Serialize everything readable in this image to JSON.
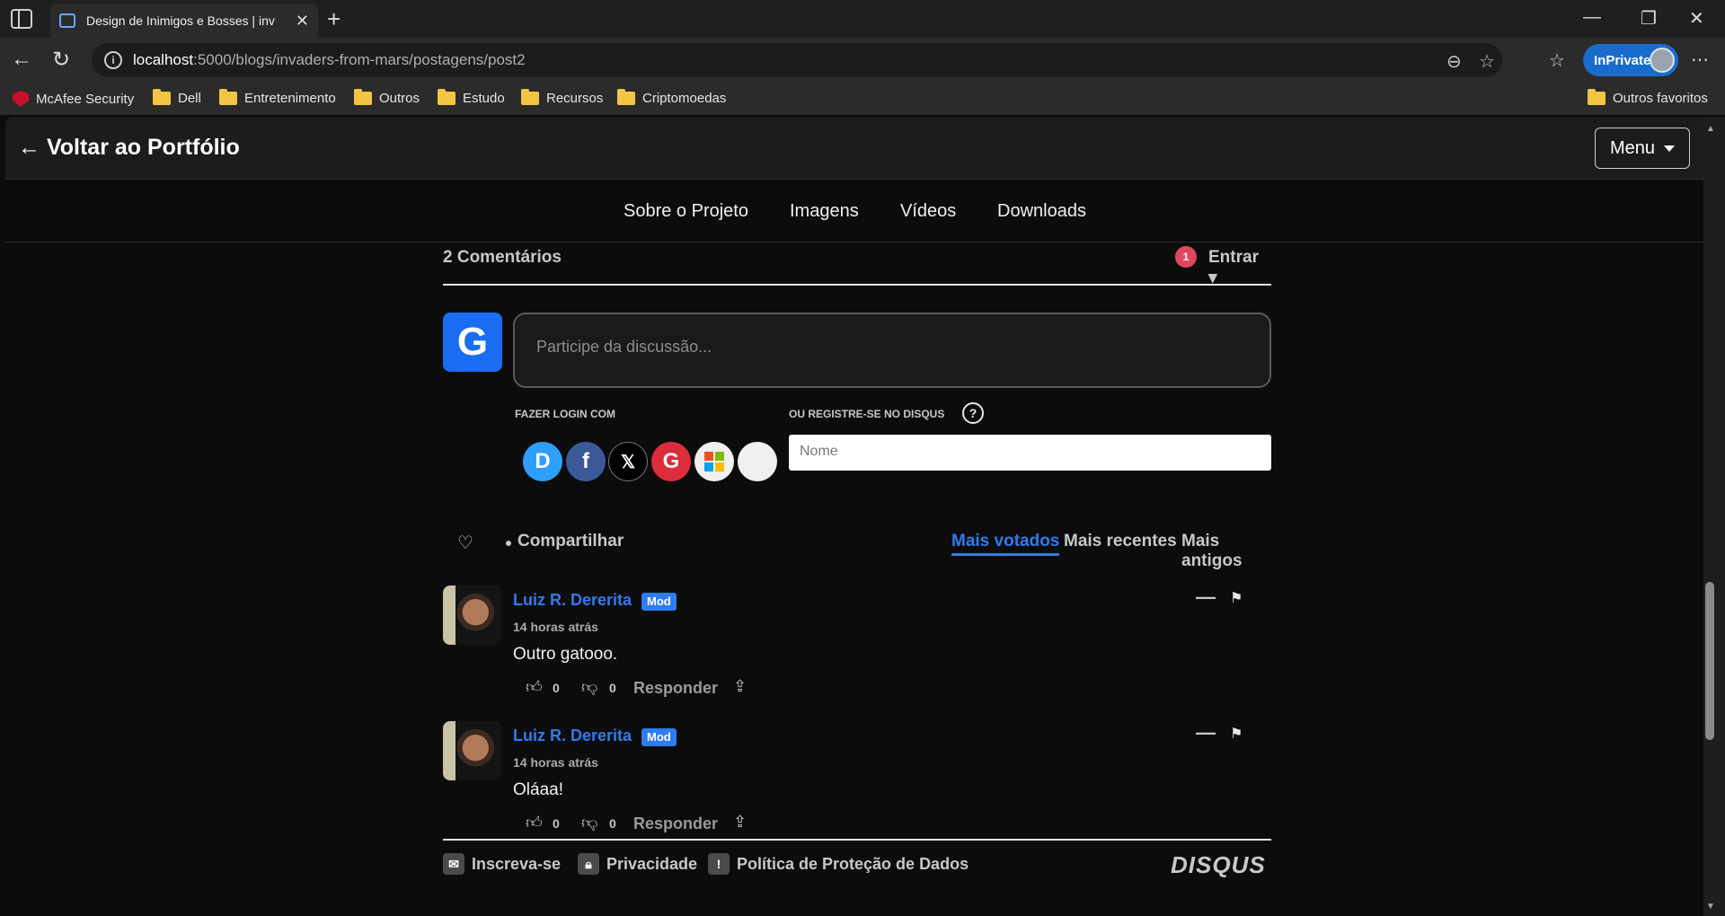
{
  "browser": {
    "tab_title": "Design de Inimigos e Bosses | inv",
    "url_host": "localhost",
    "url_path": ":5000/blogs/invaders-from-mars/postagens/post2",
    "inprivate_label": "InPrivate"
  },
  "bookmarks": {
    "items": [
      "McAfee Security",
      "Dell",
      "Entretenimento",
      "Outros",
      "Estudo",
      "Recursos",
      "Criptomoedas"
    ],
    "other": "Outros favoritos"
  },
  "site": {
    "back_link": "← Voltar ao Portfólio",
    "menu_label": "Menu",
    "subnav": [
      "Sobre o Projeto",
      "Imagens",
      "Vídeos",
      "Downloads"
    ]
  },
  "disqus": {
    "comment_count": "2 Comentários",
    "notifications": "1",
    "login_label": "Entrar ▾",
    "user_initial": "G",
    "input_placeholder": "Participe da discussão...",
    "login_with_label": "FAZER LOGIN COM",
    "register_label": "OU REGISTRE-SE NO DISQUS",
    "name_placeholder": "Nome",
    "share_label": "Compartilhar",
    "sort_tabs": [
      "Mais votados",
      "Mais recentes",
      "Mais antigos"
    ],
    "active_sort": "Mais votados",
    "comments": [
      {
        "author": "Luiz R. Dererita",
        "badge": "Mod",
        "time": "14 horas atrás",
        "text": "Outro gatooo.",
        "upvotes": "0",
        "downvotes": "0",
        "reply": "Responder"
      },
      {
        "author": "Luiz R. Dererita",
        "badge": "Mod",
        "time": "14 horas atrás",
        "text": "Oláaa!",
        "upvotes": "0",
        "downvotes": "0",
        "reply": "Responder"
      }
    ],
    "footer": {
      "subscribe": "Inscreva-se",
      "privacy": "Privacidade",
      "data_policy": "Política de Proteção de Dados",
      "logo": "DISQUS"
    }
  },
  "colors": {
    "accent": "#2e7cf0",
    "notification": "#e0475f",
    "inprivate": "#1a6ccc"
  }
}
